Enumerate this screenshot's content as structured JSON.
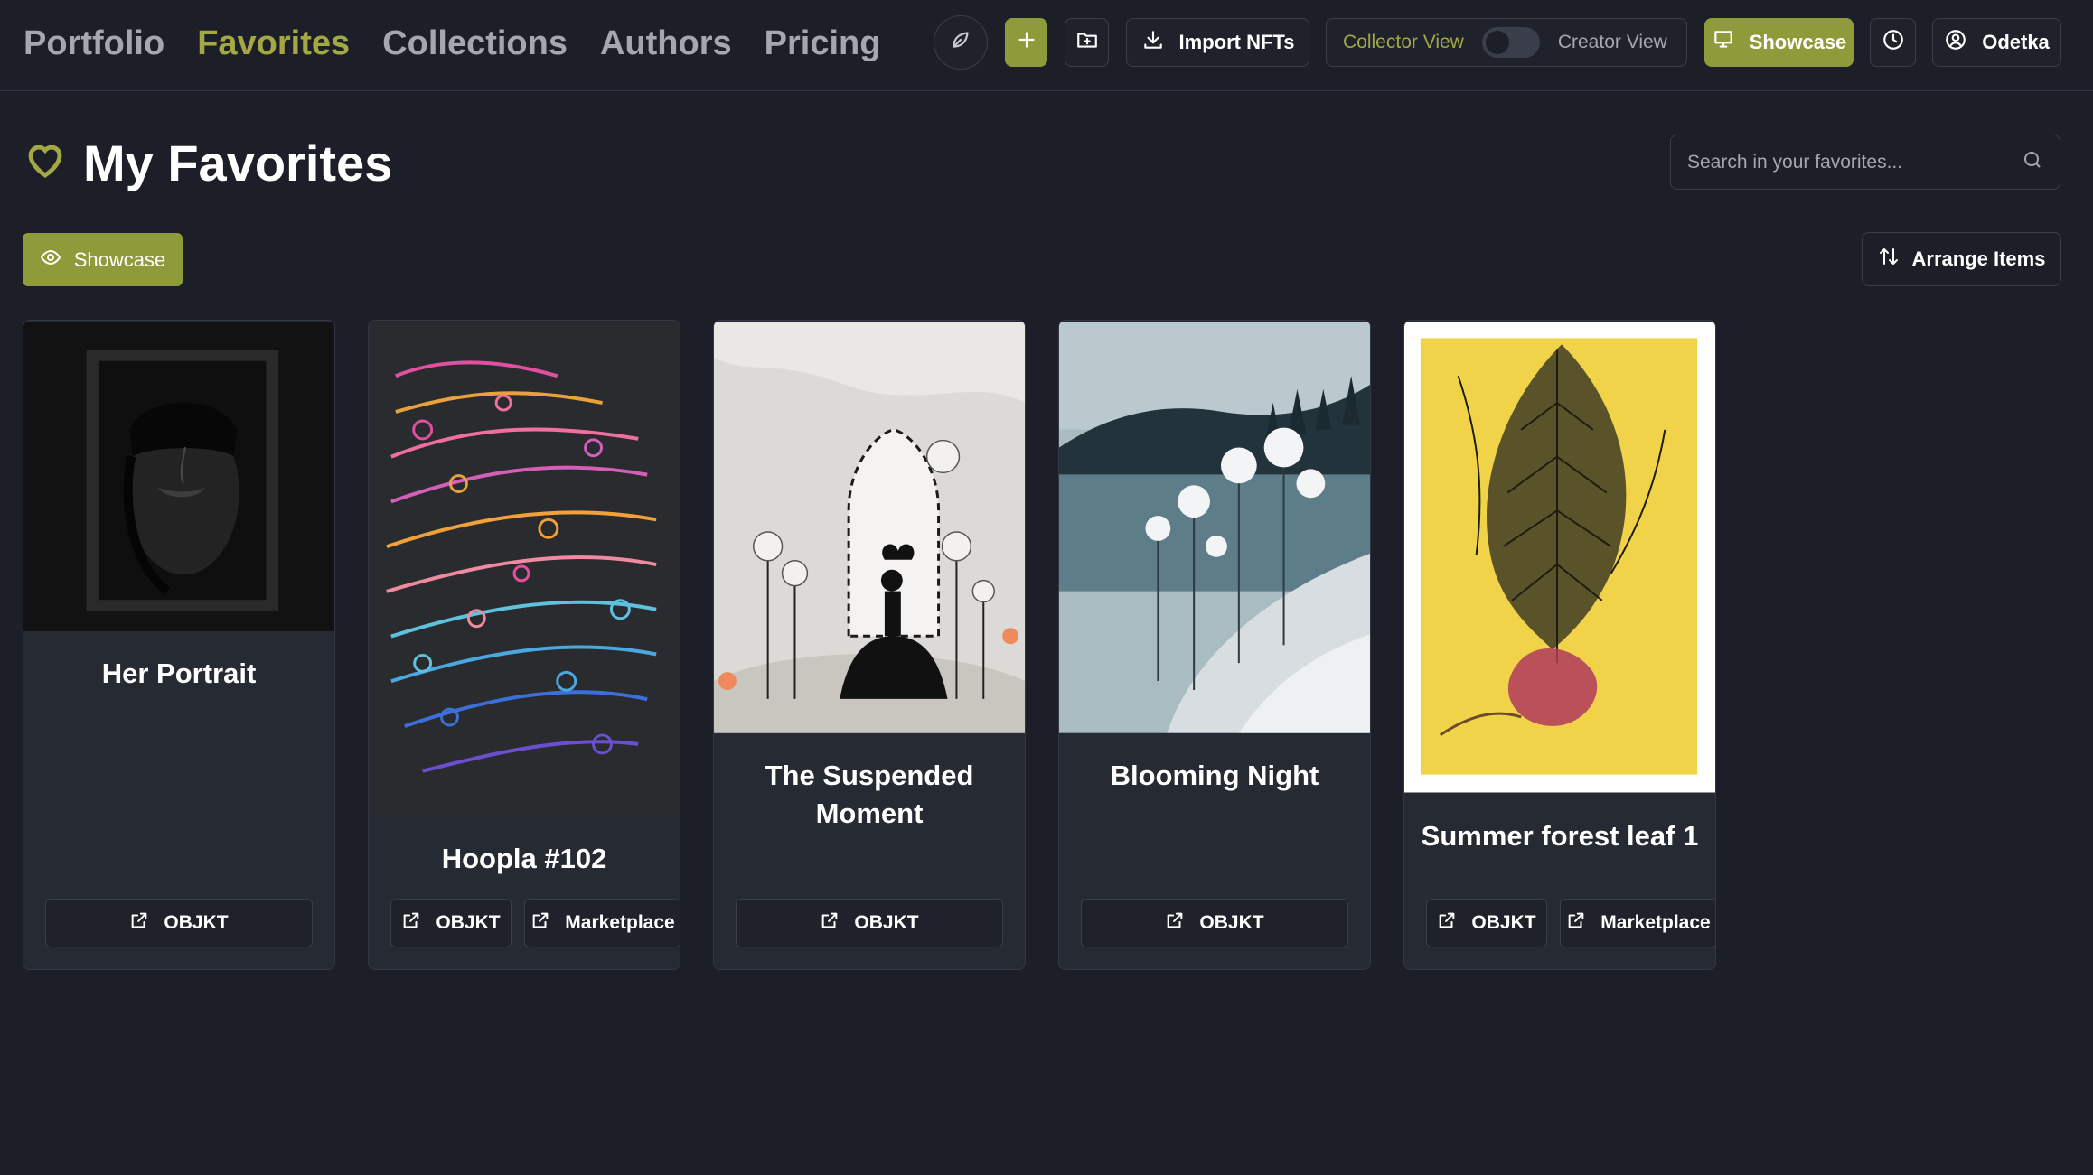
{
  "nav": {
    "links": [
      {
        "label": "Portfolio",
        "active": false
      },
      {
        "label": "Favorites",
        "active": true
      },
      {
        "label": "Collections",
        "active": false
      },
      {
        "label": "Authors",
        "active": false
      },
      {
        "label": "Pricing",
        "active": false
      }
    ],
    "import_label": "Import NFTs",
    "collector_view_label": "Collector View",
    "creator_view_label": "Creator View",
    "showcase_label": "Showcase",
    "user_label": "Odetka",
    "icons": {
      "leaf": "leaf-icon",
      "add": "plus-icon",
      "folder": "folder-plus-icon",
      "import": "download-icon",
      "showcase": "presentation-icon",
      "history": "clock-icon",
      "user": "user-circle-icon"
    }
  },
  "page": {
    "title": "My Favorites",
    "search_placeholder": "Search in your favorites...",
    "showcase_label": "Showcase",
    "arrange_label": "Arrange Items"
  },
  "cards": [
    {
      "title": "Her Portrait",
      "buttons": [
        "OBJKT"
      ]
    },
    {
      "title": "Hoopla #102",
      "buttons": [
        "OBJKT",
        "Marketplace"
      ]
    },
    {
      "title": "The Suspended Moment",
      "buttons": [
        "OBJKT"
      ]
    },
    {
      "title": "Blooming Night",
      "buttons": [
        "OBJKT"
      ]
    },
    {
      "title": "Summer forest leaf 1",
      "buttons": [
        "OBJKT",
        "Marketplace"
      ]
    }
  ],
  "colors": {
    "background": "#1c1f27",
    "card": "#262a33",
    "accent": "#8f9a3a",
    "accent_text": "#a3a845"
  }
}
